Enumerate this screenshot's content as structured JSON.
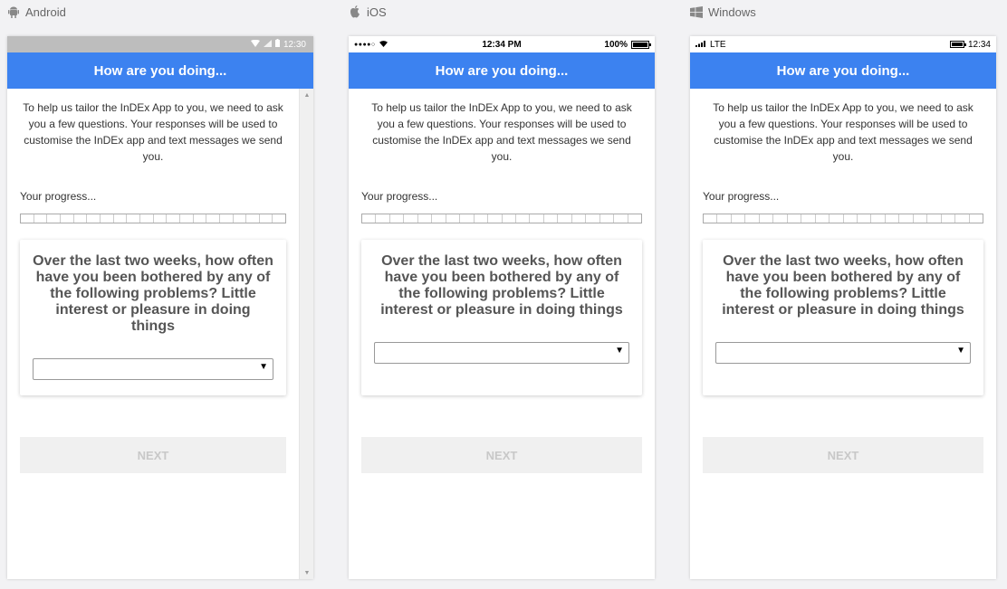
{
  "platforms": [
    {
      "label": "Android",
      "icon": "android-icon",
      "status": {
        "time": "12:30"
      }
    },
    {
      "label": "iOS",
      "icon": "apple-icon",
      "status": {
        "carrier_dots": "●●●●○",
        "time": "12:34 PM",
        "battery": "100%"
      }
    },
    {
      "label": "Windows",
      "icon": "windows-icon",
      "status": {
        "network": "LTE",
        "time": "12:34"
      }
    }
  ],
  "screen": {
    "title": "How are you doing...",
    "intro": "To help us tailor the InDEx App to you, we need to ask you a few questions. Your responses will be used to customise the InDEx app and text messages we send you.",
    "progress_label": "Your progress...",
    "progress_segments": 20,
    "progress_value": 0,
    "question": "Over the last two weeks, how often have you been bothered by any of the following problems? Little interest or pleasure in doing things",
    "select_value": "",
    "next_label": "NEXT"
  },
  "colors": {
    "header": "#3c82f0",
    "next_bg": "#f0f0f0",
    "next_text": "#c8c8c8"
  }
}
